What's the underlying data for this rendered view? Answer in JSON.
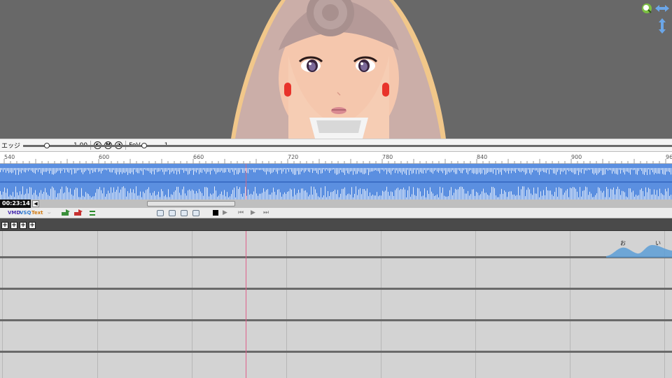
{
  "toolbar": {
    "edge_label": "エッジ",
    "edge_value": "1.00",
    "edge_fraction": 0.5,
    "fov_label": "FoV",
    "fov_value": "1",
    "fov_fraction": 0.05,
    "round_buttons": [
      "◐",
      "M",
      "◑"
    ]
  },
  "ruler": {
    "labels": [
      "540",
      "600",
      "660",
      "720",
      "780",
      "840",
      "900",
      "96"
    ]
  },
  "timeline": {
    "time": "00:23:14",
    "scroll_left": "◀"
  },
  "edit_toolbar": {
    "vmd_label": "VMD",
    "vsq_label": "VSQ",
    "text_label": "Text"
  },
  "track_header": {
    "buttons": [
      "+",
      "+",
      "+",
      "+"
    ]
  },
  "lyrics": {
    "note1": "お",
    "note2": "い"
  },
  "colors": {
    "viewport_bg": "#686868",
    "waveform": "#5b8fe0",
    "cursor": "#e0608a",
    "track_bg": "#d3d3d3"
  },
  "icons": [
    "zoom-icon",
    "horizontal-resize-icon",
    "vertical-resize-icon",
    "vmd-icon",
    "vsq-icon",
    "text-icon",
    "note-icon",
    "add-track-icon",
    "remove-track-icon",
    "swap-icon",
    "stop-icon",
    "play-icon"
  ]
}
